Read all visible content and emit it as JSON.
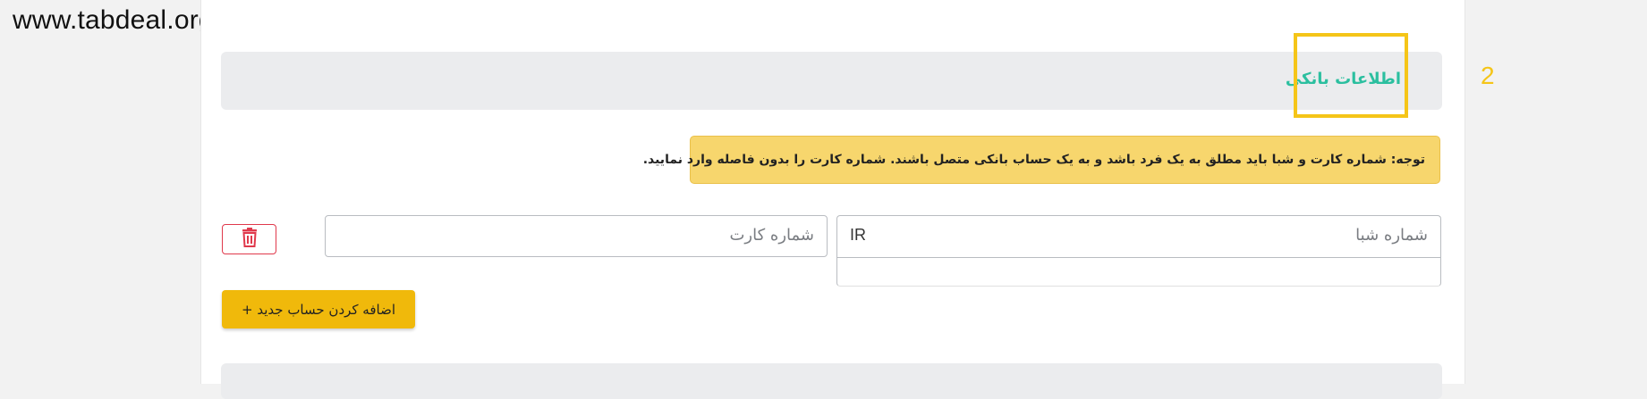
{
  "watermark": "www.tabdeal.org",
  "section": {
    "title": "اطلاعات بانکی"
  },
  "annotation": {
    "step_number": "2",
    "highlight_color": "#f5c518"
  },
  "notice": {
    "text": "توجه: شماره کارت و شبا باید مطلق به یک فرد باشد و به یک حساب بانکی متصل باشند. شماره کارت را بدون فاصله وارد نمایید."
  },
  "form": {
    "shaba_placeholder": "شماره شبا",
    "shaba_prefix": "IR",
    "card_placeholder": "شماره کارت"
  },
  "buttons": {
    "add_account_label": "اضافه کردن حساب جدید +",
    "delete_icon": "trash-icon"
  },
  "colors": {
    "accent_teal": "#2bbf9f",
    "warning_bg": "#f7d66d",
    "primary_button": "#f0b90b",
    "danger": "#e0394c"
  }
}
